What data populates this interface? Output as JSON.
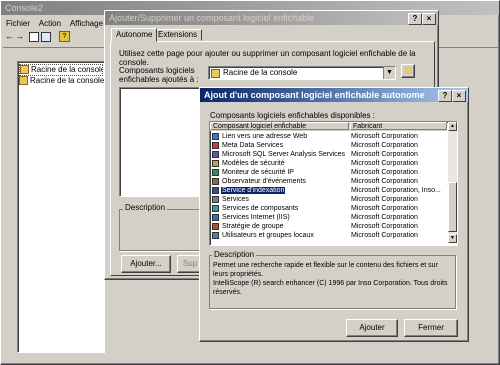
{
  "console": {
    "title": "Console2",
    "menu": [
      "Fichier",
      "Action",
      "Affichage",
      "F"
    ],
    "tree_header": "Racine de la console",
    "tree_item": "Racine de la console"
  },
  "addremove": {
    "title": "Ajouter/Supprimer un composant logiciel enfichable",
    "tabs": [
      "Autonome",
      "Extensions"
    ],
    "intro": "Utilisez cette page pour ajouter ou supprimer un composant logiciel enfichable de la console.",
    "added_label": "Composants logiciels enfichables ajoutés à :",
    "added_value": "Racine de la console",
    "description_label": "Description",
    "add_button": "Ajouter...",
    "remove_button": "Sup"
  },
  "addsnapin": {
    "title": "Ajout d'un composant logiciel enfichable autonome",
    "available_label": "Composants logiciels enfichables disponibles :",
    "columns": [
      "Composant logiciel enfichable",
      "Fabricant"
    ],
    "rows": [
      {
        "name": "Lien vers une adresse Web",
        "vendor": "Microsoft Corporation",
        "icon": "globe-icon",
        "color": "#3a7bd5"
      },
      {
        "name": "Meta Data Services",
        "vendor": "Microsoft Corporation",
        "icon": "database-icon",
        "color": "#c04040"
      },
      {
        "name": "Microsoft SQL Server Analysis Services",
        "vendor": "Microsoft Corporation",
        "icon": "cube-icon",
        "color": "#6b4fa0"
      },
      {
        "name": "Modèles de sécurité",
        "vendor": "Microsoft Corporation",
        "icon": "template-icon",
        "color": "#c8a030"
      },
      {
        "name": "Moniteur de sécurité IP",
        "vendor": "Microsoft Corporation",
        "icon": "monitor-icon",
        "color": "#2f8f5f"
      },
      {
        "name": "Observateur d'événements",
        "vendor": "Microsoft Corporation",
        "icon": "event-viewer-icon",
        "color": "#8a6a3a"
      },
      {
        "name": "Service d'indexation",
        "vendor": "Microsoft Corporation, Inso...",
        "icon": "index-icon",
        "color": "#404a80",
        "selected": true
      },
      {
        "name": "Services",
        "vendor": "Microsoft Corporation",
        "icon": "gears-icon",
        "color": "#7a7a7a"
      },
      {
        "name": "Services de composants",
        "vendor": "Microsoft Corporation",
        "icon": "components-icon",
        "color": "#3a9a9a"
      },
      {
        "name": "Services Internet (IIS)",
        "vendor": "Microsoft Corporation",
        "icon": "iis-icon",
        "color": "#3070c0"
      },
      {
        "name": "Stratégie de groupe",
        "vendor": "Microsoft Corporation",
        "icon": "policy-icon",
        "color": "#b05030"
      },
      {
        "name": "Utilisateurs et groupes locaux",
        "vendor": "Microsoft Corporation",
        "icon": "users-icon",
        "color": "#5080b0"
      }
    ],
    "description_label": "Description",
    "description_text": "Permet une recherche rapide et flexible sur le contenu des fichiers et sur leurs propriétés.",
    "description_text2": "IntelliScope (R) search enhancer (C) 1996 par Inso Corporation. Tous droits réservés.",
    "add_button": "Ajouter",
    "close_button": "Fermer"
  },
  "colors": {
    "selection": "#0a246a",
    "active_title": "#0a246a",
    "face": "#d4d0c8"
  }
}
